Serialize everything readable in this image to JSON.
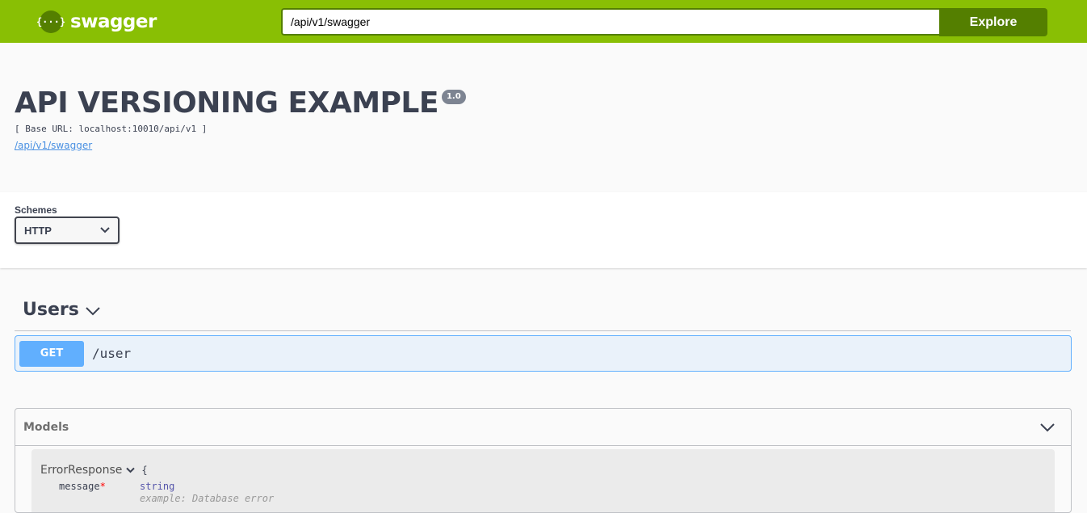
{
  "topbar": {
    "logo_icon_text": "{···}",
    "logo_text": "swagger",
    "url_value": "/api/v1/swagger",
    "explore_label": "Explore",
    "colors": {
      "bar": "#89bf04",
      "accent": "#547f00"
    }
  },
  "info": {
    "title": "API VERSIONING EXAMPLE",
    "version": "1.0",
    "base_url": "[ Base URL: localhost:10010/api/v1 ]",
    "spec_link": "/api/v1/swagger"
  },
  "schemes": {
    "label": "Schemes",
    "selected": "HTTP"
  },
  "tags": [
    {
      "name": "Users",
      "operations": [
        {
          "method": "GET",
          "path": "/user",
          "color": "#61affe"
        }
      ]
    }
  ],
  "models": {
    "title": "Models",
    "items": [
      {
        "name": "ErrorResponse",
        "open_brace": "{",
        "properties": [
          {
            "name": "message",
            "required_mark": "*",
            "type": "string",
            "example": "example: Database error"
          }
        ]
      }
    ]
  }
}
